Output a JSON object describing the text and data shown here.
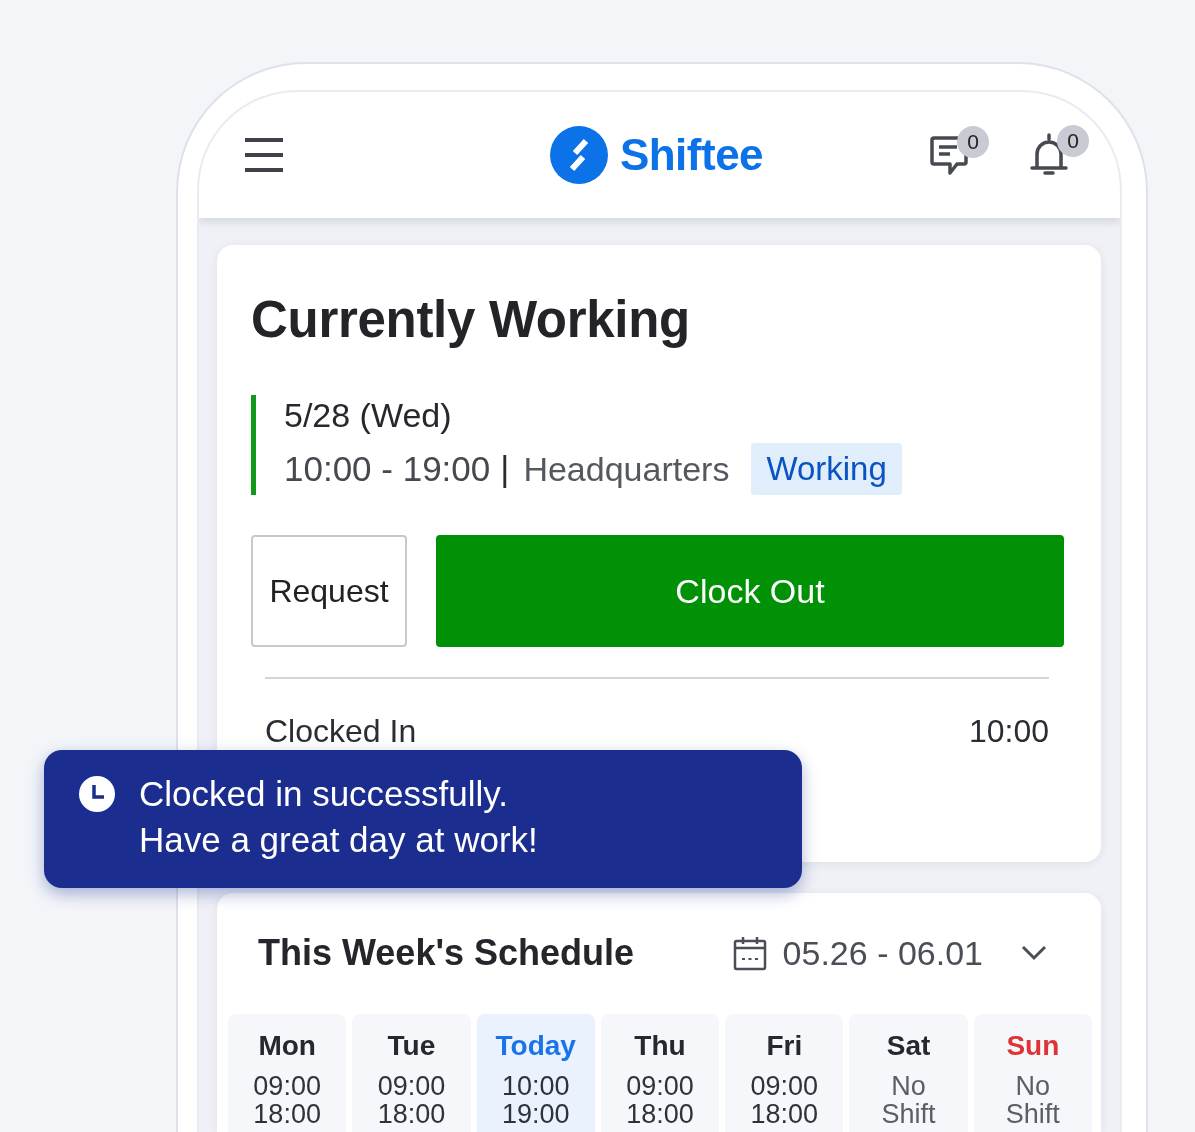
{
  "header": {
    "logo": "Shiftee",
    "message_count": "0",
    "notification_count": "0"
  },
  "current_shift": {
    "title": "Currently Working",
    "date": "5/28 (Wed)",
    "time": "10:00 - 19:00",
    "separator": "|",
    "location": "Headquarters",
    "status": "Working",
    "buttons": [
      {
        "label": "Request",
        "kind": "secondary"
      },
      {
        "label": "Clock Out",
        "kind": "primary"
      }
    ],
    "records": [
      {
        "label": "Clocked In",
        "value": "10:00"
      }
    ]
  },
  "toast": {
    "message": "Clocked in successfully.\nHave a great day at work!"
  },
  "schedule": {
    "title": "This Week's Schedule",
    "range": "05.26 - 06.01",
    "days": [
      {
        "label": "Mon",
        "selected": false,
        "holiday": false,
        "kind": "shift",
        "start": "09:00",
        "end": "18:00"
      },
      {
        "label": "Tue",
        "selected": false,
        "holiday": false,
        "kind": "shift",
        "start": "09:00",
        "end": "18:00"
      },
      {
        "label": "Today",
        "selected": true,
        "holiday": false,
        "kind": "shift",
        "start": "10:00",
        "end": "19:00"
      },
      {
        "label": "Thu",
        "selected": false,
        "holiday": false,
        "kind": "shift",
        "start": "09:00",
        "end": "18:00"
      },
      {
        "label": "Fri",
        "selected": false,
        "holiday": false,
        "kind": "shift",
        "start": "09:00",
        "end": "18:00"
      },
      {
        "label": "Sat",
        "selected": false,
        "holiday": false,
        "kind": "off",
        "note": "No Shift"
      },
      {
        "label": "Sun",
        "selected": false,
        "holiday": true,
        "kind": "off",
        "note": "No Shift"
      }
    ]
  }
}
